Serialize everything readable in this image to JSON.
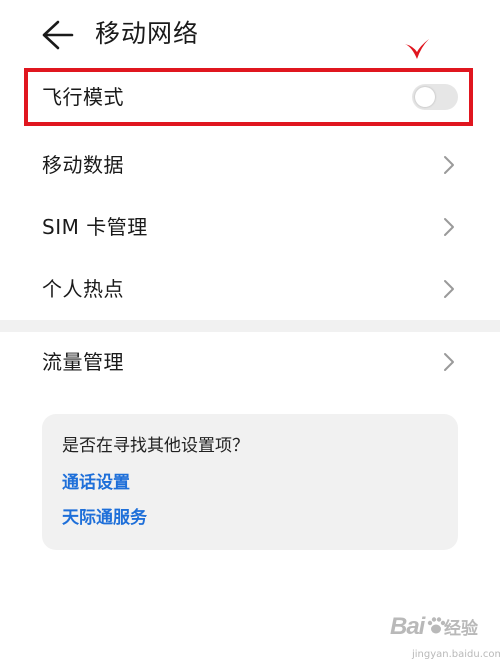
{
  "header": {
    "back_icon": "arrow-left-icon",
    "title": "移动网络"
  },
  "annotation": {
    "pointer_icon": "red-check-pointer-icon",
    "highlight_color": "#e0161f"
  },
  "settings": {
    "airplane_mode": {
      "label": "飞行模式",
      "enabled": false
    },
    "items": [
      {
        "label": "移动数据",
        "icon": "chevron-right-icon"
      },
      {
        "label": "SIM 卡管理",
        "icon": "chevron-right-icon"
      },
      {
        "label": "个人热点",
        "icon": "chevron-right-icon"
      }
    ],
    "traffic": {
      "label": "流量管理",
      "icon": "chevron-right-icon"
    }
  },
  "suggestions": {
    "title": "是否在寻找其他设置项？",
    "links": [
      "通话设置",
      "天际通服务"
    ],
    "link_color": "#1e6fd9"
  },
  "watermark": {
    "logo": "Bai",
    "brand": "经验",
    "url": "jingyan.baidu.com"
  }
}
